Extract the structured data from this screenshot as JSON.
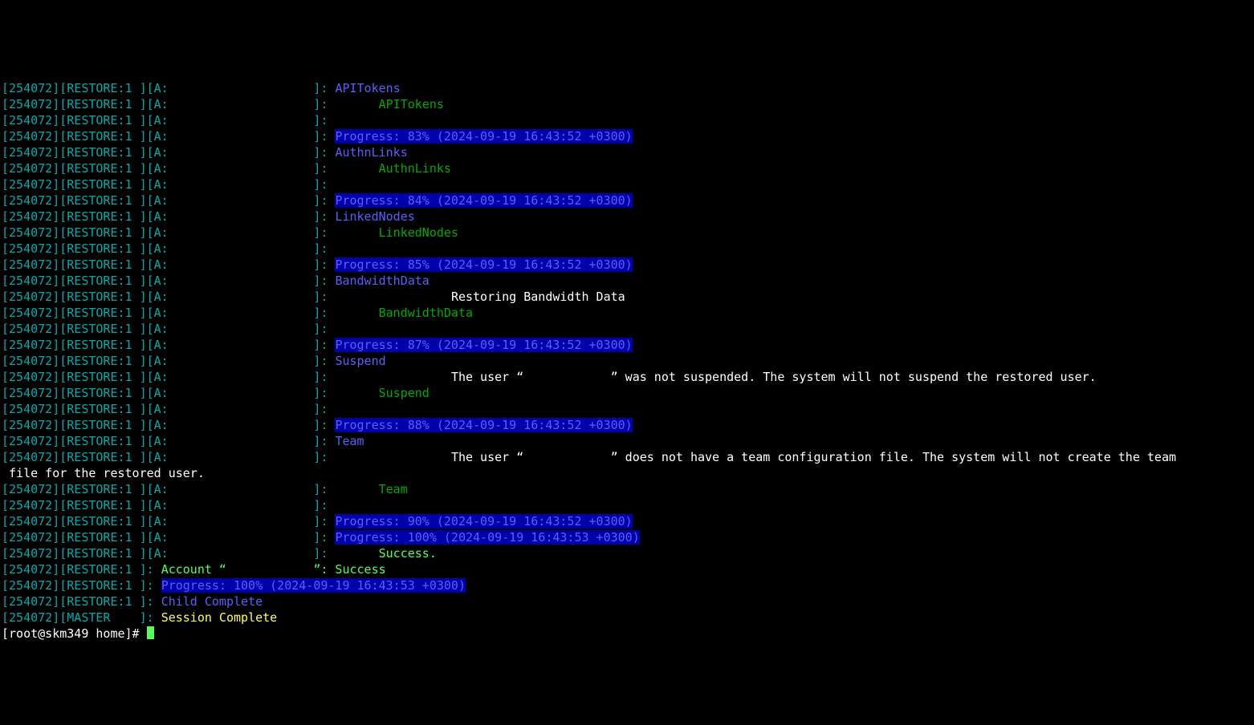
{
  "prefix_a": "[254072][RESTORE:1 ][A:",
  "prefix_s": "[254072][RESTORE:1 ]",
  "prefix_m": "[254072][MASTER    ]",
  "sep": "]:",
  "colon": ":",
  "lines": [
    {
      "type": "h",
      "text": "APITokens"
    },
    {
      "type": "g",
      "text": "APITokens"
    },
    {
      "type": "e"
    },
    {
      "type": "p",
      "text": "Progress: 83% (2024-09-19 16:43:52 +0300)"
    },
    {
      "type": "h",
      "text": "AuthnLinks"
    },
    {
      "type": "g",
      "text": "AuthnLinks"
    },
    {
      "type": "e"
    },
    {
      "type": "p",
      "text": "Progress: 84% (2024-09-19 16:43:52 +0300)"
    },
    {
      "type": "h",
      "text": "LinkedNodes"
    },
    {
      "type": "g",
      "text": "LinkedNodes"
    },
    {
      "type": "e"
    },
    {
      "type": "p",
      "text": "Progress: 85% (2024-09-19 16:43:52 +0300)"
    },
    {
      "type": "h",
      "text": "BandwidthData"
    },
    {
      "type": "w",
      "text": "Restoring Bandwidth Data",
      "pad": 16
    },
    {
      "type": "g",
      "text": "BandwidthData"
    },
    {
      "type": "e"
    },
    {
      "type": "p",
      "text": "Progress: 87% (2024-09-19 16:43:52 +0300)"
    },
    {
      "type": "h",
      "text": "Suspend"
    },
    {
      "type": "w2",
      "text1": "The user “",
      "text2": "” was not suspended. The system will not suspend the restored user.",
      "pad": 16,
      "gap": 12
    },
    {
      "type": "g",
      "text": "Suspend"
    },
    {
      "type": "e"
    },
    {
      "type": "p",
      "text": "Progress: 88% (2024-09-19 16:43:52 +0300)"
    },
    {
      "type": "h",
      "text": "Team"
    },
    {
      "type": "w2wrap",
      "text1": "The user “",
      "text2": "” does not have a team configuration file. The system will not create the team",
      "wrap": "file for the restored user.",
      "pad": 16,
      "gap": 12
    },
    {
      "type": "g",
      "text": "Team"
    },
    {
      "type": "e"
    },
    {
      "type": "p",
      "text": "Progress: 90% (2024-09-19 16:43:52 +0300)"
    },
    {
      "type": "p",
      "text": "Progress: 100% (2024-09-19 16:43:53 +0300)"
    },
    {
      "type": "lg",
      "text": "Success."
    }
  ],
  "short_lines": [
    {
      "kind": "acct",
      "text1": "Account “",
      "text2": "”: Success",
      "gap": 12
    },
    {
      "kind": "prog",
      "text": "Progress: 100% (2024-09-19 16:43:53 +0300)"
    },
    {
      "kind": "blue",
      "text": "Child Complete"
    }
  ],
  "master_line": "Session Complete",
  "prompt": {
    "full": "[root@skm349 home]# "
  }
}
